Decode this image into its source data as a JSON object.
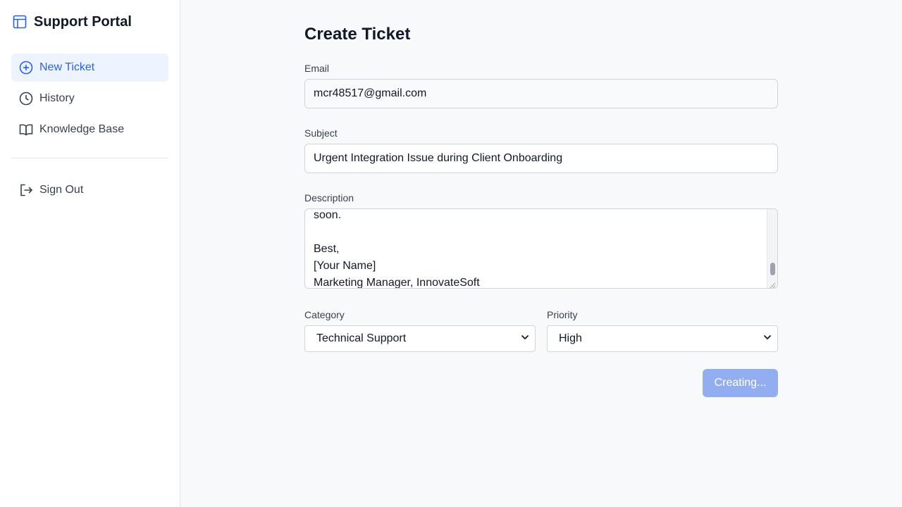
{
  "app": {
    "title": "Support Portal",
    "logo_icon": "layout-icon"
  },
  "sidebar": {
    "items": [
      {
        "label": "New Ticket",
        "icon": "plus-circle-icon",
        "active": true
      },
      {
        "label": "History",
        "icon": "clock-icon",
        "active": false
      },
      {
        "label": "Knowledge Base",
        "icon": "book-icon",
        "active": false
      }
    ],
    "sign_out": {
      "label": "Sign Out",
      "icon": "sign-out-icon"
    }
  },
  "form": {
    "title": "Create Ticket",
    "email": {
      "label": "Email",
      "value": "mcr48517@gmail.com"
    },
    "subject": {
      "label": "Subject",
      "value": "Urgent Integration Issue during Client Onboarding"
    },
    "description": {
      "label": "Description",
      "visible_text": "soon.\n\nBest,\n[Your Name]\nMarketing Manager, InnovateSoft"
    },
    "category": {
      "label": "Category",
      "selected": "Technical Support"
    },
    "priority": {
      "label": "Priority",
      "selected": "High"
    },
    "submit": {
      "label": "Creating...",
      "state": "disabled"
    }
  },
  "colors": {
    "accent": "#2563eb",
    "active_bg": "#eef4ff",
    "button_disabled": "#93aef0"
  }
}
